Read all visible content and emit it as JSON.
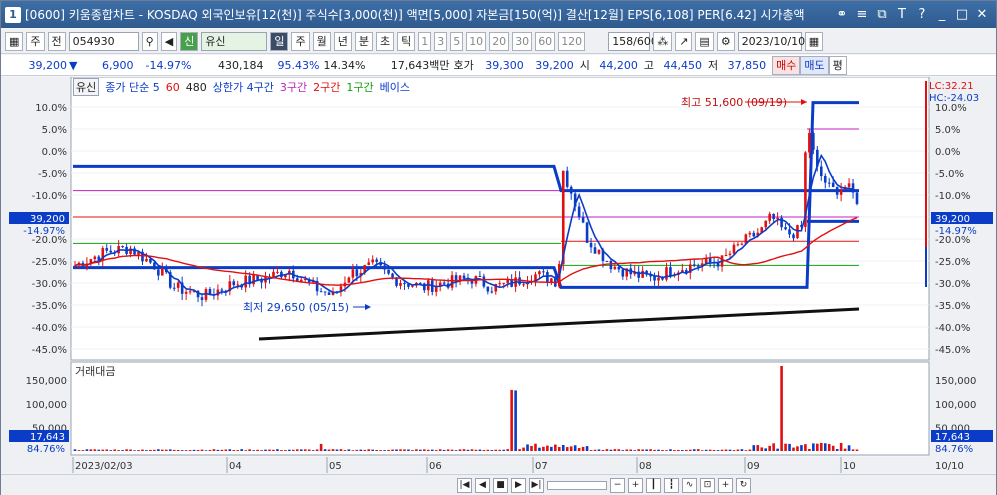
{
  "window": {
    "number": "1",
    "title": "[0600] 키움종합차트 - KOSDAQ 외국인보유[12(천)] 주식수[3,000(천)] 액면[5,000] 자본금[150(억)] 결산[12월] EPS[6,108] PER[6.42] 시가총액"
  },
  "toolbar": {
    "period_label": "주",
    "market_label": "전",
    "code": "054930",
    "stock_name_badge": "신",
    "stock_name": "유신",
    "period_buttons": [
      "일",
      "주",
      "월",
      "년",
      "분",
      "초",
      "틱"
    ],
    "interval_buttons": [
      "1",
      "3",
      "5",
      "10",
      "20",
      "30",
      "60",
      "120"
    ],
    "count": "158/600",
    "date": "2023/10/10"
  },
  "quote": {
    "price": "39,200",
    "change": "6,900",
    "change_pct": "-14.97%",
    "volume": "430,184",
    "vol_ratio": "95.43%",
    "turnover": "14.34%",
    "amount": "17,643백만",
    "ask_label": "호가",
    "ask": "39,300",
    "bid": "39,200",
    "open_label": "시",
    "open": "44,200",
    "high_label": "고",
    "high": "44,450",
    "low_label": "저",
    "low": "37,850",
    "buy": "매수",
    "sell": "매도",
    "avg": "평"
  },
  "legend": {
    "name": "유신",
    "items": [
      {
        "text": "종가 단순 5",
        "color": "#0a3cc8"
      },
      {
        "text": "60",
        "color": "#e01010"
      },
      {
        "text": "480",
        "color": "#222222"
      },
      {
        "text": "상한가 4구간",
        "color": "#0a3cc8"
      },
      {
        "text": "3구간",
        "color": "#c020c0"
      },
      {
        "text": "2구간",
        "color": "#e01010"
      },
      {
        "text": "1구간",
        "color": "#10a010"
      },
      {
        "text": "베이스",
        "color": "#0a3cc8"
      }
    ]
  },
  "price_axis": {
    "ticks": [
      "10.0%",
      "5.0%",
      "0.0%",
      "-5.0%",
      "-10.0%",
      "-15.0%",
      "-20.0%",
      "-25.0%",
      "-30.0%",
      "-35.0%",
      "-40.0%",
      "-45.0%"
    ],
    "current_label": "39,200",
    "current_pct": "-14.97%",
    "lc": "LC:32.21",
    "hc": "HC:-24.03"
  },
  "annotations": {
    "high": "최고 51,600 (09/19)",
    "low": "최저 29,650 (05/15)"
  },
  "volume_panel": {
    "title": "거래대금",
    "ticks": [
      "150,000",
      "100,000",
      "50,000"
    ],
    "current_label": "17,643",
    "current_pct": "84.76%"
  },
  "time_axis": {
    "labels": [
      "2023/02/03",
      "04",
      "05",
      "06",
      "07",
      "08",
      "09",
      "10"
    ],
    "right_label": "10/10"
  },
  "chart_data": {
    "type": "candlestick",
    "title": "유신",
    "price_range_pct": [
      -47,
      13
    ],
    "high_price": 51600,
    "high_date": "09/19",
    "low_price": 29650,
    "low_date": "05/15",
    "last_price": 39200,
    "volume_max": 180000
  }
}
